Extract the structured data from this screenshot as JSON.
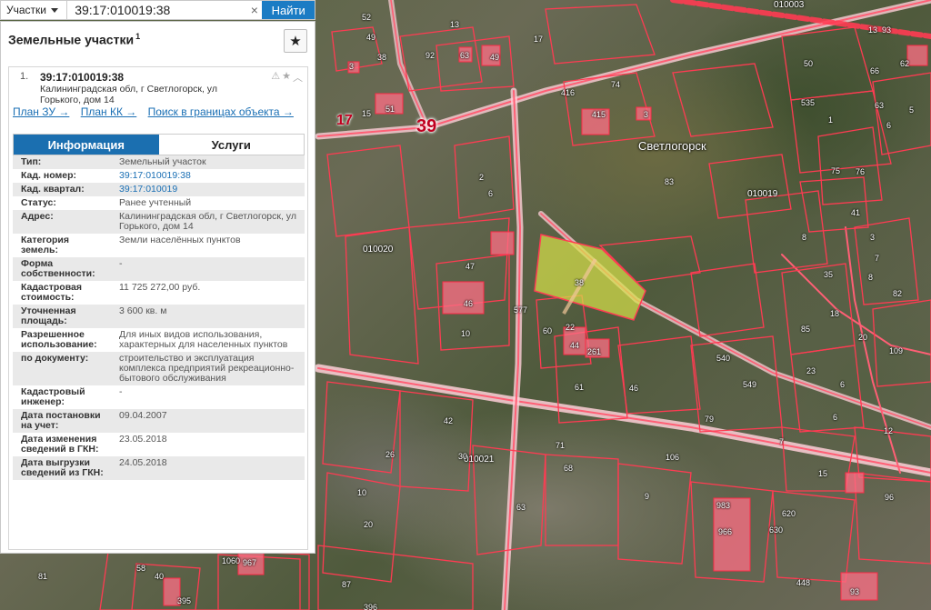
{
  "search": {
    "type_label": "Участки",
    "query": "39:17:010019:38",
    "button": "Найти",
    "clear": "×"
  },
  "panel": {
    "title": "Земельные участки",
    "title_sup": "1",
    "star_glyph": "★",
    "card": {
      "index": "1.",
      "cad_number": "39:17:010019:38",
      "address": "Калининградская обл, г Светлогорск, ул Горького, дом 14",
      "icons": [
        "warning-icon",
        "star-icon",
        "chevron-up-icon"
      ],
      "links": [
        "План ЗУ →",
        "План КК →",
        "Поиск в границах объекта →"
      ],
      "tabs": [
        "Информация",
        "Услуги"
      ],
      "active_tab": "Информация",
      "rows": [
        {
          "key": "Тип:",
          "value": "Земельный участок"
        },
        {
          "key": "Кад. номер:",
          "value": "39:17:010019:38",
          "link": true
        },
        {
          "key": "Кад. квартал:",
          "value": "39:17:010019",
          "link": true
        },
        {
          "key": "Статус:",
          "value": "Ранее учтенный"
        },
        {
          "key": "Адрес:",
          "value": "Калининградская обл, г Светлогорск, ул Горького, дом 14"
        },
        {
          "key": "Категория земель:",
          "value": "Земли населённых пунктов"
        },
        {
          "key": "Форма собственности:",
          "value": "-"
        },
        {
          "key": "Кадастровая стоимость:",
          "value": "11 725 272,00 руб."
        },
        {
          "key": "Уточненная площадь:",
          "value": "3 600 кв. м"
        },
        {
          "key": "Разрешенное использование:",
          "value": "Для иных видов использования, характерных для населенных пунктов"
        },
        {
          "key": "по документу:",
          "value": "строительство и эксплуатация комплекса предприятий рекреационно-бытового обслуживания"
        },
        {
          "key": "Кадастровый инженер:",
          "value": "-"
        },
        {
          "key": "Дата постановки на учет:",
          "value": "09.04.2007"
        },
        {
          "key": "Дата изменения сведений в ГКН:",
          "value": "23.05.2018"
        },
        {
          "key": "Дата выгрузки сведений из ГКН:",
          "value": "24.05.2018"
        }
      ]
    }
  },
  "map": {
    "town_name": "Светлогорск",
    "road_number": "39",
    "parcel_17": "17",
    "quarters": [
      "010019",
      "010020",
      "010021",
      "010003"
    ],
    "highlight_color": "#d9e24a",
    "parcel_line_color": "#ff3b52",
    "labels": [
      "52",
      "13",
      "49",
      "17",
      "92",
      "63",
      "49",
      "38",
      "3",
      "15",
      "51",
      "2",
      "416",
      "74",
      "415",
      "3",
      "535",
      "1",
      "13",
      "93",
      "50",
      "66",
      "62",
      "63",
      "6",
      "5",
      "83",
      "76",
      "75",
      "8",
      "3",
      "7",
      "8",
      "6",
      "47",
      "38",
      "577",
      "46",
      "10",
      "60",
      "44",
      "261",
      "22",
      "61",
      "46",
      "540",
      "549",
      "79",
      "85",
      "18",
      "20",
      "109",
      "82",
      "6",
      "6",
      "41",
      "35",
      "42",
      "26",
      "30",
      "71",
      "68",
      "106",
      "9",
      "63",
      "10",
      "983",
      "966",
      "630",
      "620",
      "448",
      "93",
      "1060",
      "967",
      "58",
      "40",
      "81",
      "395",
      "87",
      "396",
      "20",
      "7",
      "15",
      "96",
      "12",
      "23"
    ]
  }
}
